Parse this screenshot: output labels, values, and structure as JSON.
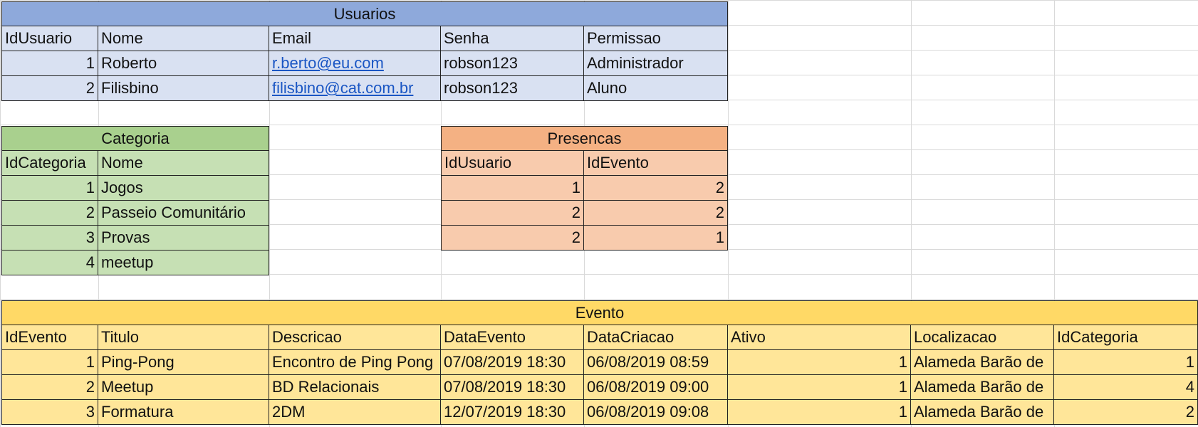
{
  "usuarios": {
    "title": "Usuarios",
    "headers": [
      "IdUsuario",
      "Nome",
      "Email",
      "Senha",
      "Permissao"
    ],
    "rows": [
      [
        "1",
        "Roberto",
        "r.berto@eu.com",
        "robson123",
        "Administrador"
      ],
      [
        "2",
        "Filisbino",
        "filisbino@cat.com.br",
        "robson123",
        "Aluno"
      ]
    ]
  },
  "categoria": {
    "title": "Categoria",
    "headers": [
      "IdCategoria",
      "Nome"
    ],
    "rows": [
      [
        "1",
        "Jogos"
      ],
      [
        "2",
        "Passeio Comunitário"
      ],
      [
        "3",
        "Provas"
      ],
      [
        "4",
        "meetup"
      ]
    ]
  },
  "presencas": {
    "title": "Presencas",
    "headers": [
      "IdUsuario",
      "IdEvento"
    ],
    "rows": [
      [
        "1",
        "2"
      ],
      [
        "2",
        "2"
      ],
      [
        "2",
        "1"
      ]
    ]
  },
  "evento": {
    "title": "Evento",
    "headers": [
      "IdEvento",
      "Titulo",
      "Descricao",
      "DataEvento",
      "DataCriacao",
      "Ativo",
      "Localizacao",
      "IdCategoria"
    ],
    "rows": [
      [
        "1",
        "Ping-Pong",
        "Encontro de Ping Pong",
        "07/08/2019 18:30",
        "06/08/2019 08:59",
        "1",
        "Alameda Barão de",
        "1"
      ],
      [
        "2",
        "Meetup",
        "BD Relacionais",
        "07/08/2019 18:30",
        "06/08/2019 09:00",
        "1",
        "Alameda Barão de",
        "4"
      ],
      [
        "3",
        "Formatura",
        "2DM",
        "12/07/2019 18:30",
        "06/08/2019 09:08",
        "1",
        "Alameda Barão de",
        "2"
      ]
    ]
  }
}
